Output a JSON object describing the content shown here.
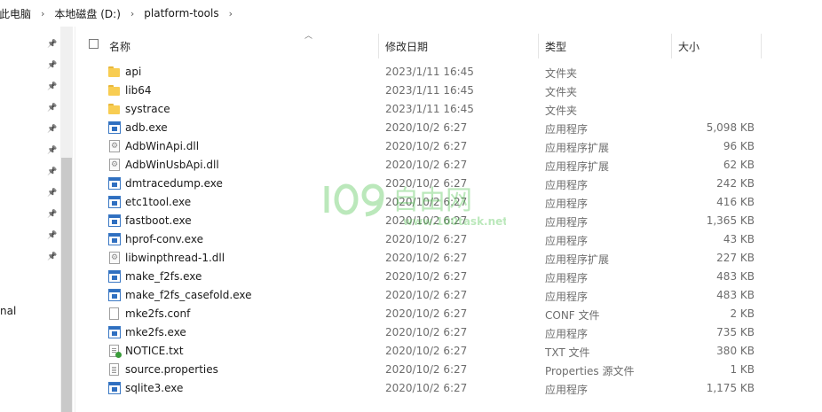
{
  "breadcrumb": {
    "items": [
      "此电脑",
      "本地磁盘 (D:)",
      "platform-tools"
    ],
    "separator": "›"
  },
  "nav": {
    "partial_label": "nal",
    "pin_count": 11
  },
  "columns": {
    "name": "名称",
    "date": "修改日期",
    "type": "类型",
    "size": "大小"
  },
  "files": [
    {
      "name": "api",
      "date": "2023/1/11 16:45",
      "type": "文件夹",
      "size": "",
      "icon": "folder-icon"
    },
    {
      "name": "lib64",
      "date": "2023/1/11 16:45",
      "type": "文件夹",
      "size": "",
      "icon": "folder-icon"
    },
    {
      "name": "systrace",
      "date": "2023/1/11 16:45",
      "type": "文件夹",
      "size": "",
      "icon": "folder-icon"
    },
    {
      "name": "adb.exe",
      "date": "2020/10/2 6:27",
      "type": "应用程序",
      "size": "5,098 KB",
      "icon": "exe-icon"
    },
    {
      "name": "AdbWinApi.dll",
      "date": "2020/10/2 6:27",
      "type": "应用程序扩展",
      "size": "96 KB",
      "icon": "dll-icon"
    },
    {
      "name": "AdbWinUsbApi.dll",
      "date": "2020/10/2 6:27",
      "type": "应用程序扩展",
      "size": "62 KB",
      "icon": "dll-icon"
    },
    {
      "name": "dmtracedump.exe",
      "date": "2020/10/2 6:27",
      "type": "应用程序",
      "size": "242 KB",
      "icon": "exe-icon"
    },
    {
      "name": "etc1tool.exe",
      "date": "2020/10/2 6:27",
      "type": "应用程序",
      "size": "416 KB",
      "icon": "exe-icon"
    },
    {
      "name": "fastboot.exe",
      "date": "2020/10/2 6:27",
      "type": "应用程序",
      "size": "1,365 KB",
      "icon": "exe-icon"
    },
    {
      "name": "hprof-conv.exe",
      "date": "2020/10/2 6:27",
      "type": "应用程序",
      "size": "43 KB",
      "icon": "exe-icon"
    },
    {
      "name": "libwinpthread-1.dll",
      "date": "2020/10/2 6:27",
      "type": "应用程序扩展",
      "size": "227 KB",
      "icon": "dll-icon"
    },
    {
      "name": "make_f2fs.exe",
      "date": "2020/10/2 6:27",
      "type": "应用程序",
      "size": "483 KB",
      "icon": "exe-icon"
    },
    {
      "name": "make_f2fs_casefold.exe",
      "date": "2020/10/2 6:27",
      "type": "应用程序",
      "size": "483 KB",
      "icon": "exe-icon"
    },
    {
      "name": "mke2fs.conf",
      "date": "2020/10/2 6:27",
      "type": "CONF 文件",
      "size": "2 KB",
      "icon": "doc-icon"
    },
    {
      "name": "mke2fs.exe",
      "date": "2020/10/2 6:27",
      "type": "应用程序",
      "size": "735 KB",
      "icon": "exe-icon"
    },
    {
      "name": "NOTICE.txt",
      "date": "2020/10/2 6:27",
      "type": "TXT 文件",
      "size": "380 KB",
      "icon": "txt-icon"
    },
    {
      "name": "source.properties",
      "date": "2020/10/2 6:27",
      "type": "Properties 源文件",
      "size": "1 KB",
      "icon": "properties-icon"
    },
    {
      "name": "sqlite3.exe",
      "date": "2020/10/2 6:27",
      "type": "应用程序",
      "size": "1,175 KB",
      "icon": "exe-icon"
    }
  ],
  "watermark": {
    "text": "100",
    "cjk": "自由网",
    "url": "www.100task.net",
    "color": "#3fbf3f"
  }
}
